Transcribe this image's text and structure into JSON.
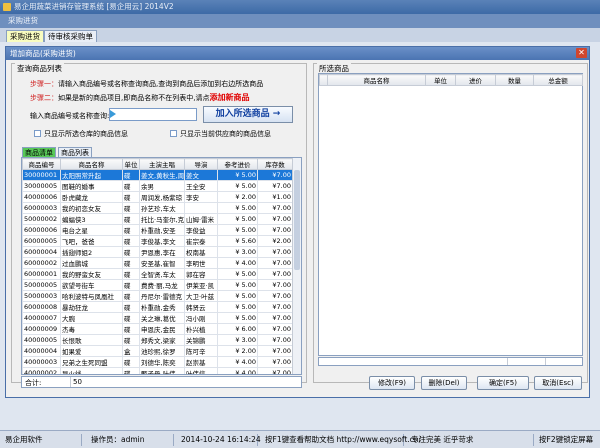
{
  "window": {
    "title": "易企用蔬菜进销存管理系统 [易企用云] 2014V2",
    "menu_label": "采购进货",
    "tabs": [
      {
        "label": "采购进货",
        "active": true
      },
      {
        "label": "待审核采购单",
        "active": false
      }
    ]
  },
  "dialog": {
    "title": "增加商品(采购进货)",
    "close_symbol": "✕",
    "search_group_title": "查询商品列表",
    "step1_label": "步骤一：",
    "step1_text": "请输入商品编号或名称查询商品,查询到商品后添加到右边所选商品",
    "step2_label": "步骤二：",
    "step2_text": "如果是新的商品项目,即商品名称不在列表中,请点",
    "step2_link": "添加新商品",
    "input_label": "输入商品编号或名称查询:",
    "input_value": "",
    "add_button": "加入所选商品 →",
    "checkbox1": "只显示所选仓库的商品信息",
    "checkbox2": "只显示当前供应商的商品信息",
    "inner_tabs": [
      {
        "label": "商品清单",
        "active": true
      },
      {
        "label": "商品列表",
        "active": false
      }
    ],
    "grid_columns": [
      "商品编号",
      "商品名称",
      "单位",
      "主演主唱",
      "导演",
      "参考进价",
      "库存数"
    ],
    "grid_rows": [
      [
        "30000001",
        "太阳照常升起",
        "碟",
        "姜文,黄秋生,周",
        "姜文",
        "¥ 5.00",
        "¥7.00"
      ],
      [
        "30000005",
        "图鞋的婚事",
        "碟",
        "余男",
        "王全安",
        "¥ 5.00",
        "¥7.00"
      ],
      [
        "40000006",
        "卧虎藏龙",
        "碟",
        "周润发,杨紫琼",
        "李安",
        "¥ 2.00",
        "¥1.00"
      ],
      [
        "60000003",
        "我的初恋女友",
        "碟",
        "孙艺珍,车太",
        "",
        "¥ 5.00",
        "¥7.00"
      ],
      [
        "50000002",
        "蝙蝠侠3",
        "碟",
        "托比·马奎尔,克",
        "山姆·雷米",
        "¥ 5.00",
        "¥7.00"
      ],
      [
        "60000006",
        "电台之星",
        "碟",
        "朴重勋,安圣",
        "李俊益",
        "¥ 5.00",
        "¥7.00"
      ],
      [
        "60000005",
        "飞吧，爸爸",
        "碟",
        "李俊基,李文",
        "崔宗泰",
        "¥ 5.60",
        "¥2.00"
      ],
      [
        "60000004",
        "插翅师姐2",
        "碟",
        "尹恩惠,李在",
        "权南基",
        "¥ 3.00",
        "¥7.00"
      ],
      [
        "60000002",
        "过血鹏城",
        "碟",
        "安圣基,崔智",
        "李明世",
        "¥ 4.00",
        "¥7.00"
      ],
      [
        "60000001",
        "我的野蛮女友",
        "碟",
        "全智贤,车太",
        "郭在容",
        "¥ 5.00",
        "¥7.00"
      ],
      [
        "50000005",
        "欲望号街车",
        "碟",
        "费费·丽,马龙",
        "伊莱亚·凯",
        "¥ 5.00",
        "¥7.00"
      ],
      [
        "50000003",
        "哈利波特与凤凰社",
        "碟",
        "丹尼尔·雷德克",
        "大卫·叶兹",
        "¥ 5.00",
        "¥7.00"
      ],
      [
        "60000008",
        "暴劫狂龙",
        "碟",
        "朴重勋,金秀",
        "韩贤云",
        "¥ 5.00",
        "¥7.00"
      ],
      [
        "40000007",
        "大腕",
        "碟",
        "关之琳,葛优",
        "冯小刚",
        "¥ 5.00",
        "¥7.00"
      ],
      [
        "40000009",
        "杰毒",
        "碟",
        "申恩庆,金民",
        "朴兴植",
        "¥ 6.00",
        "¥7.00"
      ],
      [
        "40000005",
        "长恨歌",
        "碟",
        "郑秀文,梁家",
        "关锦鹏",
        "¥ 3.00",
        "¥7.00"
      ],
      [
        "40000004",
        "如果爱",
        "盒",
        "池珍熙,徐罗",
        "陈可辛",
        "¥ 2.00",
        "¥7.00"
      ],
      [
        "40000003",
        "兄弟之生死同盟",
        "碟",
        "刘德华,陈奕",
        "赵崇基",
        "¥ 4.00",
        "¥7.00"
      ],
      [
        "40000002",
        "导火线",
        "碟",
        "甄子丹,叶伟",
        "叶伟信",
        "¥ 4.00",
        "¥7.00"
      ]
    ],
    "total_label": "合计:",
    "total_value": "50",
    "selected_group_title": "所选商品",
    "selected_columns": [
      "商品名称",
      "单位",
      "进价",
      "数量",
      "总金额"
    ],
    "buttons": {
      "modify": "修改(F9)",
      "delete": "删除(Del)",
      "confirm": "确定(F5)",
      "cancel": "取消(Esc)"
    }
  },
  "status_bar": {
    "app": "易企用软件",
    "operator": "操作员：admin",
    "datetime": "2014-10-24 16:14:24",
    "help": "按F1键查看帮助文档  http://www.eqysoft.cn/",
    "slogan": "专注完美  近乎苛求",
    "lock": "按F2键锁定屏幕"
  },
  "colors": {
    "selected_row": "#1c78d8",
    "active_tab": "#58c858",
    "step_red": "#d02020"
  }
}
